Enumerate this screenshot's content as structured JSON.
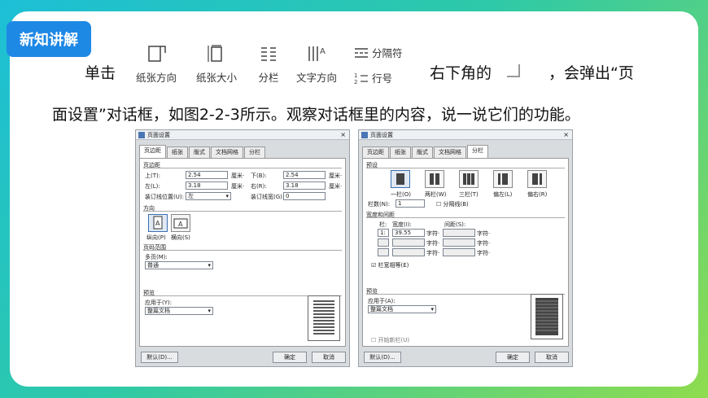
{
  "tag": "新知讲解",
  "para": {
    "pre": "单击",
    "mid": "右下角的",
    "post": "，会弹出“页",
    "line2": "面设置”对话框，如图2-2-3所示。观察对话框里的内容，说一说它们的功能。"
  },
  "ribbon": {
    "paper_dir": "纸张方向",
    "paper_size": "纸张大小",
    "columns": "分栏",
    "text_dir": "文字方向",
    "breaks": "分隔符",
    "line_no": "行号"
  },
  "left": {
    "title": "页面设置",
    "close": "×",
    "tabs": [
      "页边距",
      "纸张",
      "版式",
      "文档网格",
      "分栏"
    ],
    "margins": "页边距",
    "top": "上(T):",
    "top_v": "2.54",
    "bottom": "下(B):",
    "bottom_v": "2.54",
    "left": "左(L):",
    "left_v": "3.18",
    "right": "右(R):",
    "right_v": "3.18",
    "unit": "厘米·",
    "gutter_pos": "装订线位置(U):",
    "gutter_pos_v": "左",
    "gutter": "装订线宽(G):",
    "gutter_v": "0",
    "orient": "方向",
    "portrait": "纵向(P)",
    "landscape": "横向(S)",
    "pages": "页码范围",
    "multi": "多页(M):",
    "multi_v": "普通",
    "preview": "预览",
    "apply": "应用于(Y):",
    "apply_v": "整篇文档",
    "default": "默认(D)...",
    "ok": "确定",
    "cancel": "取消"
  },
  "right": {
    "title": "页面设置",
    "close": "×",
    "tabs": [
      "页边距",
      "纸张",
      "版式",
      "文档网格",
      "分栏"
    ],
    "preset": "预设",
    "p1": "一栏(O)",
    "p2": "两栏(W)",
    "p3": "三栏(T)",
    "p4": "偏左(L)",
    "p5": "偏右(R)",
    "numcols": "栏数(N):",
    "numcols_v": "1",
    "sepline": "分隔线(B)",
    "wandsp": "宽度和间距",
    "col": "栏:",
    "width": "宽度(I):",
    "spacing": "间距(S):",
    "c1": "1:",
    "w1": "39.55",
    "unit": "字符·",
    "equal": "栏宽相等(E)",
    "preview": "预览",
    "apply": "应用于(A):",
    "apply_v": "整篇文档",
    "newcol": "开始新栏(U)",
    "default": "默认(D)...",
    "ok": "确定",
    "cancel": "取消"
  }
}
